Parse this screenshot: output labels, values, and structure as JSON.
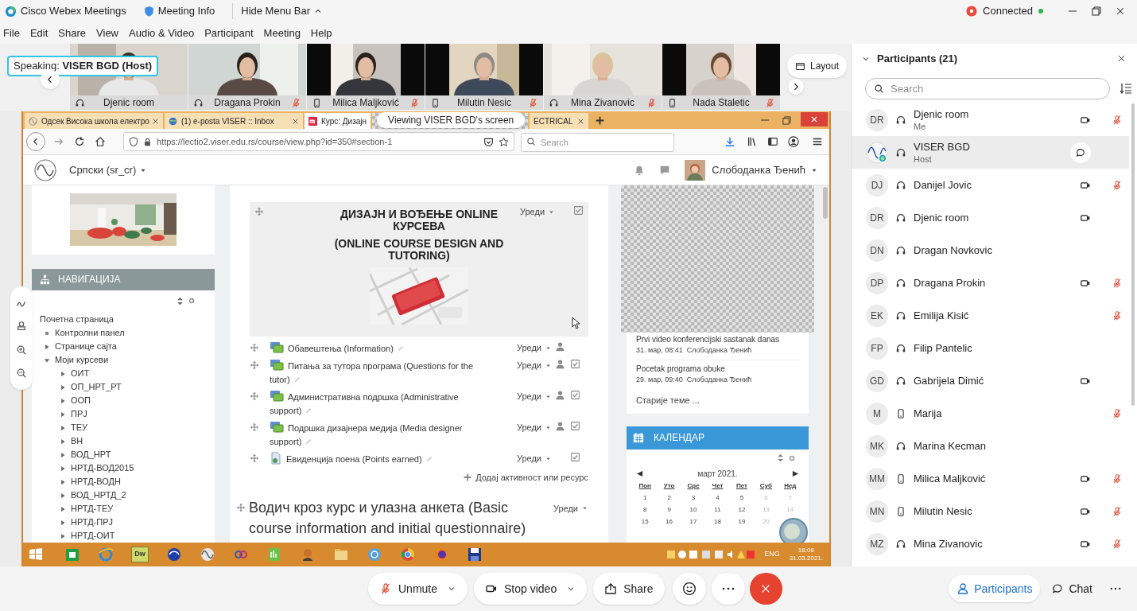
{
  "title_bar": {
    "app": "Cisco Webex Meetings",
    "meeting_info": "Meeting Info",
    "hide_menu": "Hide Menu Bar",
    "status": "Connected"
  },
  "menu": [
    "File",
    "Edit",
    "Share",
    "View",
    "Audio & Video",
    "Participant",
    "Meeting",
    "Help"
  ],
  "speaking": "Speaking: **VISER BGD (Host)**",
  "video_tiles": [
    {
      "name": "Djenic room",
      "kind": "headset",
      "muted": false
    },
    {
      "name": "Dragana Prokin",
      "kind": "headset",
      "muted": true
    },
    {
      "name": "Milica Maljković",
      "kind": "phone",
      "muted": true
    },
    {
      "name": "Milutin Nesic",
      "kind": "phone",
      "muted": true
    },
    {
      "name": "Mina Zivanovic",
      "kind": "headset",
      "muted": true
    },
    {
      "name": "Nada Staletic",
      "kind": "phone",
      "muted": true
    }
  ],
  "layout_button": "Layout",
  "shared_screen": {
    "banner": "Viewing VISER BGD's screen",
    "browser_tabs": [
      {
        "title": "Одсек Висока школа електро",
        "selected": false
      },
      {
        "title": "(1) e-posta VISER :: Inbox",
        "selected": false
      },
      {
        "title": "Курс: Дизајн",
        "selected": true
      },
      {
        "title": "ECTRICAL",
        "selected": false
      }
    ],
    "url": "https://lectio2.viser.edu.rs/course/view.php?id=350#section-1",
    "search_placeholder": "Search",
    "language": "Српски (sr_cr)",
    "user": "Слободанка Ђенић",
    "navigation": {
      "title": "НАВИГАЦИЈА",
      "items": [
        {
          "label": "Почетна страница",
          "kind": "root",
          "children": [
            {
              "label": "Контролни панел",
              "kind": "leaf"
            },
            {
              "label": "Странице сајта",
              "kind": "branch",
              "expanded": false
            },
            {
              "label": "Моји курсеви",
              "kind": "branch",
              "expanded": true,
              "children": [
                {
                  "label": "ОИТ",
                  "kind": "branch",
                  "expanded": false
                },
                {
                  "label": "ОП_НРТ_РТ",
                  "kind": "branch",
                  "expanded": false
                },
                {
                  "label": "ООП",
                  "kind": "branch",
                  "expanded": false
                },
                {
                  "label": "ПРЈ",
                  "kind": "branch",
                  "expanded": false
                },
                {
                  "label": "ТЕУ",
                  "kind": "branch",
                  "expanded": false
                },
                {
                  "label": "ВН",
                  "kind": "branch",
                  "expanded": false
                },
                {
                  "label": "ВОД_НРТ",
                  "kind": "branch",
                  "expanded": false
                },
                {
                  "label": "НРТД-ВОД2015",
                  "kind": "branch",
                  "expanded": false
                },
                {
                  "label": "НРТД-ВОДН",
                  "kind": "branch",
                  "expanded": false
                },
                {
                  "label": "ВОД_НРТД_2",
                  "kind": "branch",
                  "expanded": false
                },
                {
                  "label": "НРТД-ТЕУ",
                  "kind": "branch",
                  "expanded": false
                },
                {
                  "label": "НРТД-ПРЈ",
                  "kind": "branch",
                  "expanded": false
                },
                {
                  "label": "НРТД-ОИТ",
                  "kind": "branch",
                  "expanded": false
                }
              ]
            }
          ]
        }
      ]
    },
    "section": {
      "title": "ДИЗАЈН И ВОЂЕЊЕ ONLINE КУРСЕВА",
      "subtitle": "(ONLINE COURSE DESIGN AND TUTORING)",
      "edit": "Уреди"
    },
    "activities": [
      {
        "kind": "forum",
        "title": "Обавештења (Information)",
        "edit": "Уреди",
        "group_mode": true,
        "completion": false
      },
      {
        "kind": "forum",
        "title": "Питања за тутора програма (Questions for the tutor)",
        "edit": "Уреди",
        "group_mode": true,
        "completion": true
      },
      {
        "kind": "forum",
        "title": "Административна подршка (Administrative support)",
        "edit": "Уреди",
        "group_mode": true,
        "completion": true
      },
      {
        "kind": "forum",
        "title": "Подршка дизајнера медија (Media designer support)",
        "edit": "Уреди",
        "group_mode": true,
        "completion": true
      },
      {
        "kind": "page",
        "title": "Евиденција поена (Points earned)",
        "edit": "Уреди",
        "group_mode": false,
        "completion": true
      }
    ],
    "add_activity": "Додај активност или ресурс",
    "next_section": {
      "title": "Водич кроз курс и улазна анкета (Basic course information and initial questionnaire)",
      "edit": "Уреди"
    },
    "forum_posts": [
      {
        "title": "Prvi video konferencijski sastanak danas",
        "meta": "31. мар, 08:41  Слободанка Ђенић"
      },
      {
        "title": "Pocetak programa obuke",
        "meta": "29. мар, 09:40  Слободанка Ђенић"
      }
    ],
    "older_topics": "Старије теме ...",
    "calendar": {
      "title": "КАЛЕНДАР",
      "month": "март 2021.",
      "weekdays": [
        "Пон",
        "Уто",
        "Сре",
        "Чет",
        "Пет",
        "Суб",
        "Нед"
      ],
      "weeks": [
        [
          "1",
          "2",
          "3",
          "4",
          "5",
          "6",
          "7"
        ],
        [
          "8",
          "9",
          "10",
          "11",
          "12",
          "13",
          "14"
        ],
        [
          "15",
          "16",
          "17",
          "18",
          "19",
          "20"
        ]
      ]
    },
    "taskbar": {
      "app_badge": "Dw",
      "language": "ENG",
      "time": "18:08",
      "date": "31.03.2021."
    }
  },
  "participants": {
    "title": "Participants (21)",
    "search_placeholder": "Search",
    "items": [
      {
        "initials": "DR",
        "name": "Djenic room",
        "note": "Me",
        "kind": "headset",
        "video": true,
        "muted": true,
        "selected": false
      },
      {
        "name": "VISER BGD",
        "note": "Host",
        "kind": "headset",
        "video": false,
        "muted": false,
        "selected": true
      },
      {
        "initials": "DJ",
        "name": "Danijel Jovic",
        "kind": "headset",
        "video": true,
        "muted": true,
        "selected": false
      },
      {
        "initials": "DR",
        "name": "Djenic room",
        "kind": "headset",
        "video": true,
        "muted": false,
        "selected": false
      },
      {
        "initials": "DN",
        "name": "Dragan Novkovic",
        "kind": "headset",
        "video": false,
        "muted": false,
        "selected": false
      },
      {
        "initials": "DP",
        "name": "Dragana Prokin",
        "kind": "headset",
        "video": true,
        "muted": true,
        "selected": false
      },
      {
        "initials": "EK",
        "name": "Emilija Kisić",
        "kind": "headset",
        "video": false,
        "muted": true,
        "selected": false
      },
      {
        "initials": "FP",
        "name": "Filip Pantelic",
        "kind": "headset",
        "video": false,
        "muted": false,
        "selected": false
      },
      {
        "initials": "GD",
        "name": "Gabrijela Dimić",
        "kind": "headset",
        "video": true,
        "muted": false,
        "selected": false
      },
      {
        "initials": "M",
        "name": "Marija",
        "kind": "phone",
        "video": false,
        "muted": true,
        "selected": false
      },
      {
        "initials": "MK",
        "name": "Marina Kecman",
        "kind": "headset",
        "video": false,
        "muted": false,
        "selected": false
      },
      {
        "initials": "MM",
        "name": "Milica Maljković",
        "kind": "phone",
        "video": true,
        "muted": true,
        "selected": false
      },
      {
        "initials": "MN",
        "name": "Milutin Nesic",
        "kind": "phone",
        "video": true,
        "muted": true,
        "selected": false
      },
      {
        "initials": "MZ",
        "name": "Mina Zivanovic",
        "kind": "headset",
        "video": true,
        "muted": true,
        "selected": false
      }
    ]
  },
  "controls": [
    {
      "kind": "mute",
      "label": "Unmute"
    },
    {
      "kind": "video",
      "label": "Stop video"
    },
    {
      "kind": "share",
      "label": "Share"
    },
    {
      "kind": "reactions"
    },
    {
      "kind": "more"
    },
    {
      "kind": "leave"
    }
  ],
  "panel_buttons": [
    {
      "kind": "participants",
      "label": "Participants",
      "selected": true
    },
    {
      "kind": "chat",
      "label": "Chat",
      "selected": false
    },
    {
      "kind": "more"
    }
  ]
}
